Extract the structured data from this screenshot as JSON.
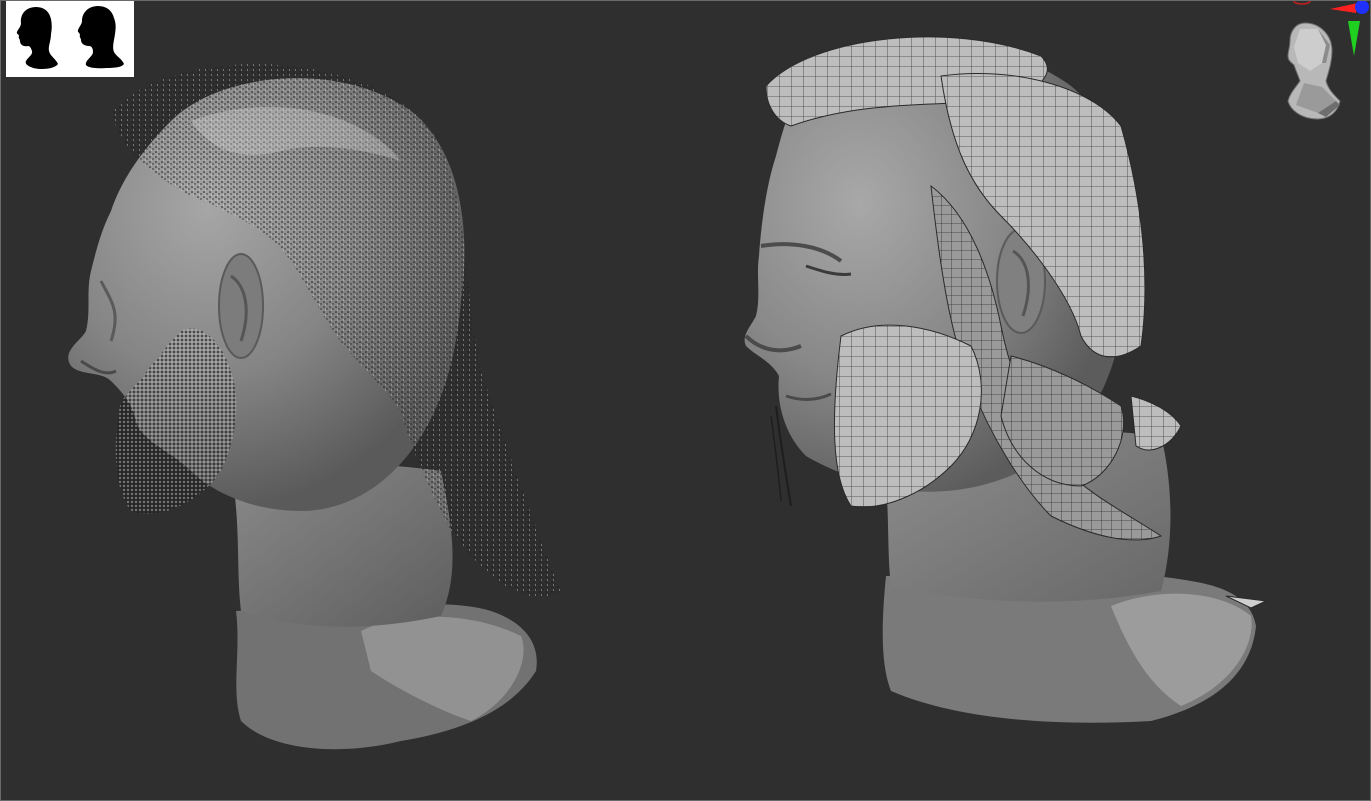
{
  "canvas": {
    "background": "#2f2f2f",
    "border_color": "#6a6a6a"
  },
  "thumbnail": {
    "icons": [
      "head-silhouette-front-icon",
      "head-silhouette-side-icon"
    ],
    "background": "#ffffff",
    "silhouette_color": "#000000"
  },
  "gizmo": {
    "icon": "head-orientation-gizmo-icon",
    "axis_colors": {
      "x": "#ff2020",
      "y": "#20d020",
      "z": "#2030ff"
    }
  },
  "models": [
    {
      "name": "sculpted-head-with-hair-points",
      "material": "#8a8a8a"
    },
    {
      "name": "sculpted-head-with-hair-cards",
      "material": "#8c8c8c"
    }
  ]
}
